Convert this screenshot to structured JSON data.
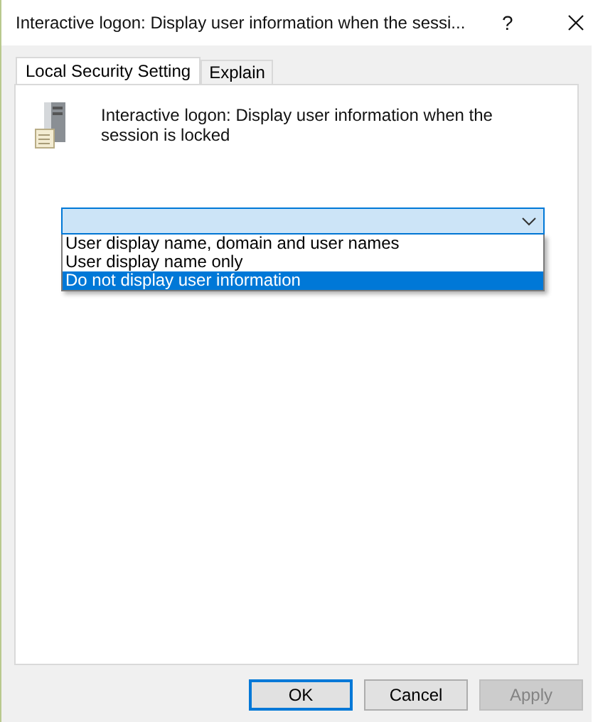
{
  "window": {
    "title": "Interactive logon: Display user information when the sessi...",
    "help": "?"
  },
  "tabs": [
    {
      "label": "Local Security Setting",
      "selected": true
    },
    {
      "label": "Explain",
      "selected": false
    }
  ],
  "setting": {
    "description": "Interactive logon: Display user information when the session is locked"
  },
  "dropdown": {
    "open": true,
    "options": [
      {
        "label": "User display name, domain and user names",
        "selected": false
      },
      {
        "label": "User display name only",
        "selected": false
      },
      {
        "label": "Do not display user information",
        "selected": true
      }
    ]
  },
  "buttons": [
    {
      "label": "OK",
      "default": true,
      "disabled": false
    },
    {
      "label": "Cancel",
      "default": false,
      "disabled": false
    },
    {
      "label": "Apply",
      "default": false,
      "disabled": true
    }
  ]
}
